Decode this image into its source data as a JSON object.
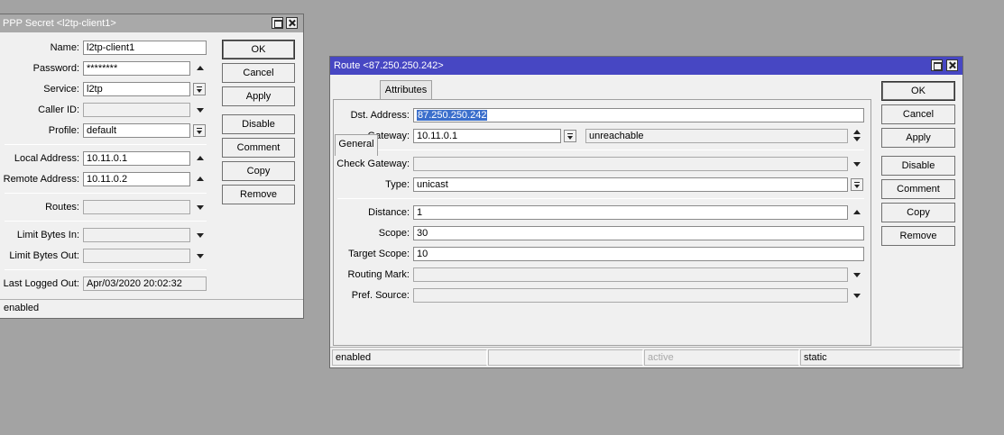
{
  "ppp": {
    "title": "PPP Secret <l2tp-client1>",
    "labels": {
      "name": "Name:",
      "password": "Password:",
      "service": "Service:",
      "caller_id": "Caller ID:",
      "profile": "Profile:",
      "local_address": "Local Address:",
      "remote_address": "Remote Address:",
      "routes": "Routes:",
      "limit_in": "Limit Bytes In:",
      "limit_out": "Limit Bytes Out:",
      "last_logged_out": "Last Logged Out:"
    },
    "values": {
      "name": "l2tp-client1",
      "password": "********",
      "service": "l2tp",
      "caller_id": "",
      "profile": "default",
      "local_address": "10.11.0.1",
      "remote_address": "10.11.0.2",
      "routes": "",
      "limit_in": "",
      "limit_out": "",
      "last_logged_out": "Apr/03/2020 20:02:32"
    },
    "buttons": {
      "ok": "OK",
      "cancel": "Cancel",
      "apply": "Apply",
      "disable": "Disable",
      "comment": "Comment",
      "copy": "Copy",
      "remove": "Remove"
    },
    "status": "enabled"
  },
  "route": {
    "title": "Route <87.250.250.242>",
    "tabs": [
      "General",
      "Attributes"
    ],
    "labels": {
      "dst": "Dst. Address:",
      "gateway": "Gateway:",
      "check_gateway": "Check Gateway:",
      "type": "Type:",
      "distance": "Distance:",
      "scope": "Scope:",
      "target_scope": "Target Scope:",
      "routing_mark": "Routing Mark:",
      "pref_source": "Pref. Source:"
    },
    "values": {
      "dst": "87.250.250.242",
      "gateway": "10.11.0.1",
      "gateway_state": "unreachable",
      "check_gateway": "",
      "type": "unicast",
      "distance": "1",
      "scope": "30",
      "target_scope": "10",
      "routing_mark": "",
      "pref_source": ""
    },
    "buttons": {
      "ok": "OK",
      "cancel": "Cancel",
      "apply": "Apply",
      "disable": "Disable",
      "comment": "Comment",
      "copy": "Copy",
      "remove": "Remove"
    },
    "status": [
      "enabled",
      "",
      "active",
      "static"
    ]
  },
  "colors": {
    "desktop": "#a3a3a3",
    "active_title": "#4747c3",
    "inactive_title": "#a9a9a9",
    "selection": "#3b6fcc"
  }
}
